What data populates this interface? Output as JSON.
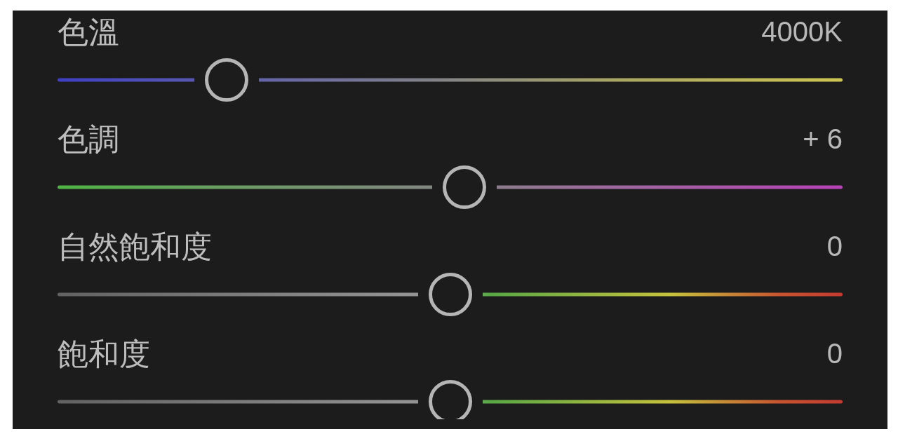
{
  "sliders": [
    {
      "label": "色溫",
      "value": "4000K",
      "kind": "temperature",
      "level": 0.215
    },
    {
      "label": "色調",
      "value": "+ 6",
      "kind": "tint",
      "level": 0.518
    },
    {
      "label": "自然飽和度",
      "value": "0",
      "kind": "saturation",
      "level": 0.5
    },
    {
      "label": "飽和度",
      "value": "0",
      "kind": "saturation",
      "level": 0.5
    }
  ]
}
